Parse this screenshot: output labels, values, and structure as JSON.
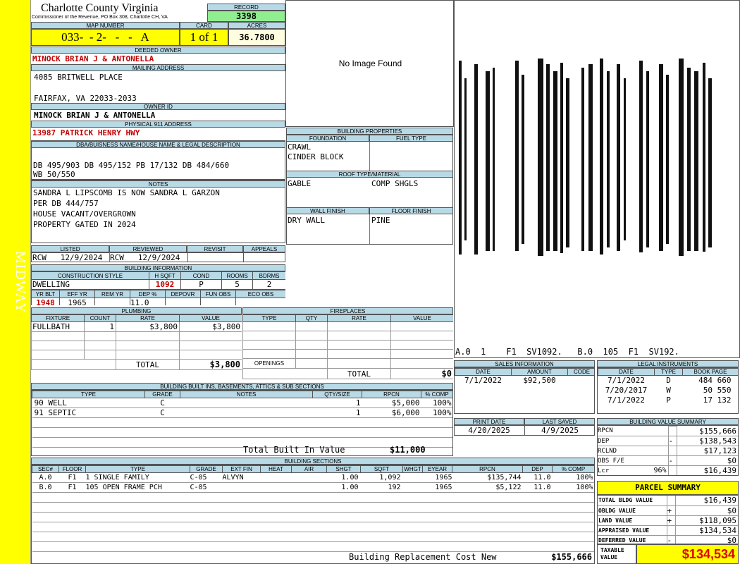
{
  "side_label": "MIDWAY",
  "county": "Charlotte County Virginia",
  "commissioner": "Commissioner of the Revenue, PO Box 308, Charlotte CH, VA",
  "record": {
    "label": "RECORD",
    "value": "3398"
  },
  "map": {
    "label": "MAP NUMBER",
    "value": "033-  - 2-   -   -   A"
  },
  "card": {
    "label": "CARD",
    "value": "1 of 1"
  },
  "acres": {
    "label": "ACRES",
    "value": "36.7800"
  },
  "deeded_owner": {
    "label": "DEEDED OWNER",
    "value": "MINOCK BRIAN J & ANTONELLA"
  },
  "mailing": {
    "label": "MAILING ADDRESS",
    "line1": "4085 BRITWELL PLACE",
    "line2": "FAIRFAX, VA 22033-2033"
  },
  "owner_id": {
    "label": "OWNER ID",
    "value": "MINOCK BRIAN J & ANTONELLA"
  },
  "physical": {
    "label": "PHYSICAL 911 ADDRESS",
    "value": "13987 PATRICK HENRY HWY"
  },
  "dba": {
    "label": "DBA/BUISNESS NAME/HOUSE NAME & LEGAL DESCRIPTION",
    "line1": "DB 495/903 DB 495/152 PB 17/132 DB 484/660",
    "line2": "WB 50/550"
  },
  "notes": {
    "label": "NOTES",
    "lines": [
      "SANDRA L LIPSCOMB IS NOW SANDRA L GARZON",
      "PER DB 444/757",
      "HOUSE VACANT/OVERGROWN",
      "PROPERTY GATED IN 2024"
    ]
  },
  "listed": {
    "label": "LISTED",
    "value": "RCW   12/9/2024"
  },
  "reviewed": {
    "label": "REVIEWED",
    "value": "RCW   12/9/2024"
  },
  "revisit": {
    "label": "REVISIT",
    "value": ""
  },
  "appeals": {
    "label": "APPEALS",
    "value": ""
  },
  "building_info": {
    "label": "BUILDING INFORMATION",
    "h1": [
      "CONSTRUCTION STYLE",
      "H SQFT",
      "COND",
      "ROOMS",
      "BDRMS"
    ],
    "v1": [
      "DWELLING",
      "1092",
      "P",
      "5",
      "2"
    ],
    "h2": [
      "YR BLT",
      "EFF YR",
      "REM YR",
      "DEP %",
      "DEPOVR",
      "FUN OBS",
      "ECO OBS"
    ],
    "v2": [
      "1948",
      "1965",
      "",
      "11.0",
      "",
      "",
      ""
    ]
  },
  "plumbing": {
    "label": "PLUMBING",
    "headers": [
      "FIXTURE",
      "COUNT",
      "RATE",
      "VALUE"
    ],
    "rows": [
      [
        "FULLBATH",
        "1",
        "$3,800",
        "$3,800"
      ]
    ],
    "total_label": "TOTAL",
    "total": "$3,800"
  },
  "fireplaces": {
    "label": "FIREPLACES",
    "headers": [
      "TYPE",
      "QTY",
      "RATE",
      "VALUE"
    ],
    "openings_label": "OPENINGS",
    "total_label": "TOTAL",
    "total": "$0"
  },
  "no_image": "No Image Found",
  "building_props": {
    "label": "BUILDING PROPERTIES",
    "foundation_label": "FOUNDATION",
    "fueltype_label": "FUEL TYPE",
    "foundation": [
      "CRAWL",
      "CINDER BLOCK"
    ],
    "roof_label": "ROOF TYPE/MATERIAL",
    "roof_type": "GABLE",
    "roof_material": "COMP SHGLS",
    "wall_label": "WALL FINISH",
    "floor_label": "FLOOR FINISH",
    "wall": "DRY WALL",
    "floor": "PINE"
  },
  "sketch": {
    "caption": "A.0  1    F1  SV1092.   B.0  105  F1  SV192."
  },
  "sales": {
    "label": "SALES INFORMATION",
    "headers": [
      "DATE",
      "AMOUNT",
      "CODE"
    ],
    "rows": [
      [
        "7/1/2022",
        "$92,500",
        ""
      ]
    ]
  },
  "legal": {
    "label": "LEGAL INSTRUMENTS",
    "headers": [
      "DATE",
      "TYPE",
      "BOOK PAGE"
    ],
    "rows": [
      [
        "7/1/2022",
        "D",
        "484 660"
      ],
      [
        "7/20/2017",
        "W",
        "50 550"
      ],
      [
        "7/1/2022",
        "P",
        "17 132"
      ]
    ]
  },
  "print_date": {
    "label": "PRINT DATE",
    "value": "4/20/2025"
  },
  "last_saved": {
    "label": "LAST SAVED",
    "value": "4/9/2025"
  },
  "built_ins": {
    "label": "BUILDING BUILT INS, BASEMENTS, ATTICS & SUB SECTIONS",
    "headers": [
      "TYPE",
      "GRADE",
      "NOTES",
      "QTY/SIZE",
      "RPCN",
      "% COMP"
    ],
    "rows": [
      [
        "90 WELL",
        "C",
        "",
        "1",
        "$5,000",
        "100%"
      ],
      [
        "91 SEPTIC",
        "C",
        "",
        "1",
        "$6,000",
        "100%"
      ]
    ],
    "total_label": "Total Built In Value",
    "total": "$11,000"
  },
  "bvs": {
    "label": "BUILDING VALUE SUMMARY",
    "rows": [
      {
        "label": "RPCN",
        "sign": "",
        "pct": "",
        "value": "$155,666"
      },
      {
        "label": "DEP",
        "sign": "-",
        "pct": "",
        "value": "$138,543"
      },
      {
        "label": "RCLND",
        "sign": "",
        "pct": "",
        "value": "$17,123"
      },
      {
        "label": "OBS F/E",
        "sign": "-",
        "pct": "",
        "value": "$0"
      },
      {
        "label": "Lcr",
        "sign": "",
        "pct": "96%",
        "value": "$16,439"
      }
    ]
  },
  "sections": {
    "label": "BUILDING SECTIONS",
    "headers": [
      "SEC#",
      "FLOOR",
      "TYPE",
      "GRADE",
      "EXT FIN",
      "HEAT",
      "AIR",
      "SHGT",
      "SQFT",
      "WHGT",
      "EYEAR",
      "RPCN",
      "DEP",
      "% COMP"
    ],
    "rows": [
      [
        "A.0",
        "F1",
        "1 SINGLE FAMILY",
        "C-05",
        "ALVYN",
        "",
        "",
        "1.00",
        "1,092",
        "",
        "1965",
        "$135,744",
        "11.0",
        "100%"
      ],
      [
        "B.0",
        "F1",
        "105 OPEN FRAME PCH",
        "C-05",
        "",
        "",
        "",
        "1.00",
        "192",
        "",
        "1965",
        "$5,122",
        "11.0",
        "100%"
      ]
    ],
    "total_label": "Building Replacement Cost New",
    "total": "$155,666"
  },
  "parcel": {
    "title": "PARCEL SUMMARY",
    "rows": [
      {
        "label": "TOTAL BLDG VALUE",
        "sign": "",
        "value": "$16,439"
      },
      {
        "label": "OBLDG VALUE",
        "sign": "+",
        "value": "$0"
      },
      {
        "label": "LAND VALUE",
        "sign": "+",
        "value": "$118,095"
      },
      {
        "label": "APPRAISED VALUE",
        "sign": "",
        "value": "$134,534"
      },
      {
        "label": "DEFERRED VALUE",
        "sign": "-",
        "value": "$0"
      }
    ],
    "taxable_label": "TAXABLE VALUE",
    "taxable": "$134,534"
  }
}
